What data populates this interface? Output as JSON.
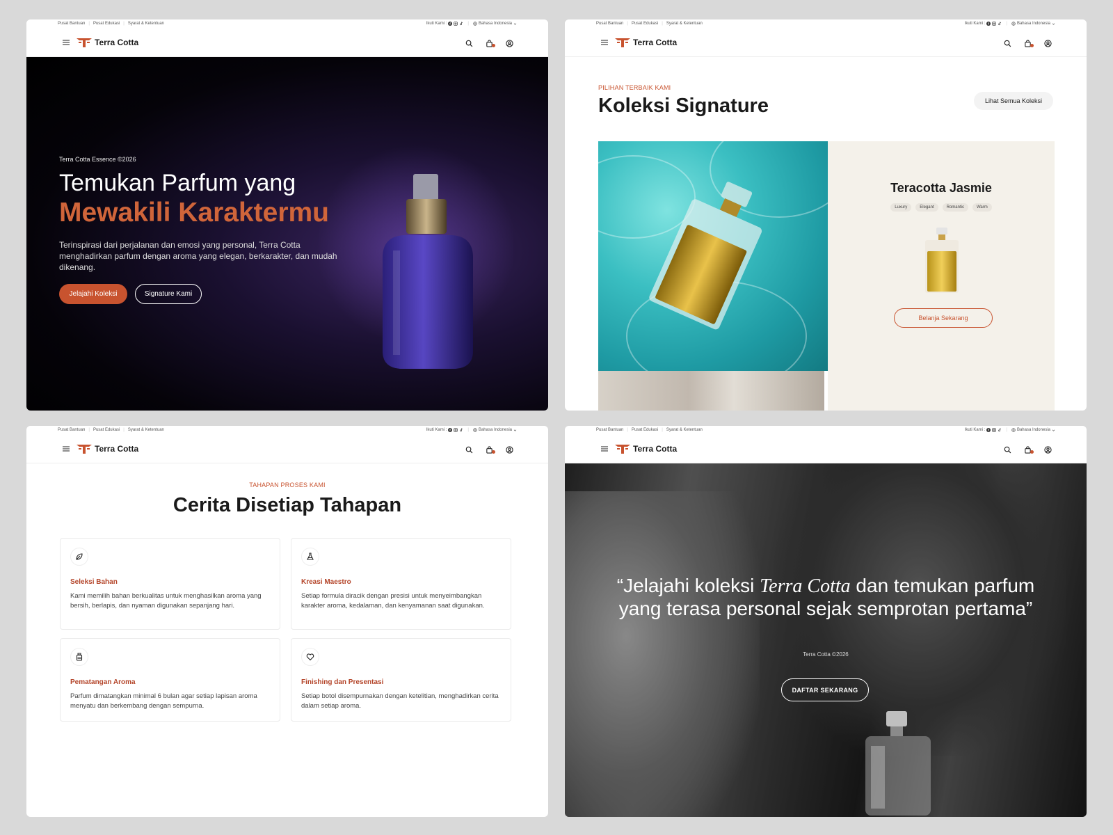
{
  "topbar": {
    "links": [
      "Pusat Bantuan",
      "Pusat Edukasi",
      "Syarat & Ketentuan"
    ],
    "follow_label": "Ikuti Kami :",
    "language": "Bahasa Indonesia"
  },
  "nav": {
    "brand": "Terra Cotta"
  },
  "colors": {
    "accent": "#c8532f",
    "dark": "#1a1a1a"
  },
  "icons": [
    "menu-icon",
    "logo-icon",
    "search-icon",
    "bag-icon",
    "user-icon",
    "facebook-icon",
    "instagram-icon",
    "tiktok-icon",
    "globe-icon",
    "chevron-down-icon",
    "leaf-icon",
    "flask-icon",
    "bottle-icon",
    "heart-icon"
  ],
  "hero": {
    "eyebrow": "Terra Cotta Essence ©2026",
    "headline_line1": "Temukan Parfum yang",
    "headline_line2": "Mewakili Karaktermu",
    "description": "Terinspirasi dari perjalanan dan emosi yang personal, Terra Cotta menghadirkan parfum dengan aroma yang elegan, berkarakter, dan mudah dikenang.",
    "primary_button": "Jelajahi Koleksi",
    "secondary_button": "Signature Kami"
  },
  "signature": {
    "eyebrow": "PILIHAN TERBAIK KAMI",
    "title": "Koleksi Signature",
    "view_all": "Lihat Semua Koleksi",
    "product": {
      "name": "Teracotta Jasmie",
      "tags": [
        "Luxury",
        "Elegant",
        "Romantic",
        "Warm"
      ],
      "button": "Belanja Sekarang"
    }
  },
  "process": {
    "eyebrow": "TAHAPAN PROSES KAMI",
    "title": "Cerita Disetiap Tahapan",
    "steps": [
      {
        "title": "Seleksi Bahan",
        "desc": "Kami memilih bahan berkualitas untuk menghasilkan aroma yang bersih, berlapis, dan nyaman digunakan sepanjang hari.",
        "icon": "leaf-icon"
      },
      {
        "title": "Kreasi Maestro",
        "desc": "Setiap formula diracik dengan presisi untuk menyeimbangkan karakter aroma, kedalaman, dan kenyamanan saat digunakan.",
        "icon": "flask-icon"
      },
      {
        "title": "Pematangan Aroma",
        "desc": "Parfum dimatangkan minimal 6 bulan agar setiap lapisan aroma menyatu dan berkembang dengan sempurna.",
        "icon": "bottle-icon"
      },
      {
        "title": "Finishing dan Presentasi",
        "desc": "Setiap botol disempurnakan dengan ketelitian, menghadirkan cerita dalam setiap aroma.",
        "icon": "heart-icon"
      }
    ]
  },
  "cta": {
    "quote_pre": "“Jelajahi koleksi ",
    "quote_brand": "Terra Cotta",
    "quote_post": " dan temukan parfum yang terasa personal sejak semprotan pertama”",
    "sub": "Terra Cotta ©2026",
    "button": "DAFTAR SEKARANG"
  }
}
